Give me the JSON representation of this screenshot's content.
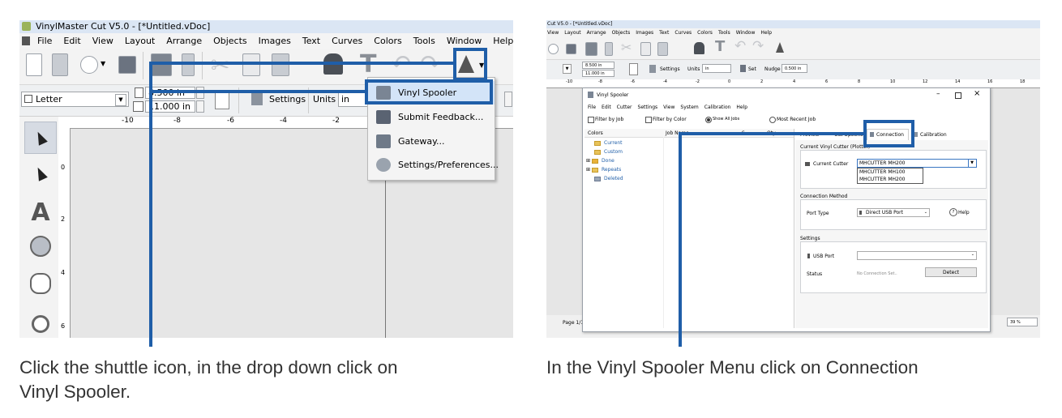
{
  "left_panel": {
    "window_title": "VinylMaster Cut V5.0 - [*Untitled.vDoc]",
    "menu": [
      "File",
      "Edit",
      "View",
      "Layout",
      "Arrange",
      "Objects",
      "Images",
      "Text",
      "Curves",
      "Colors",
      "Tools",
      "Window",
      "Help"
    ],
    "page_size": "Letter",
    "width_value": "8.500 in",
    "height_value": "11.000 in",
    "settings_label": "Settings",
    "units_label": "Units",
    "units_value": "in",
    "ruler_h": [
      "-10",
      "-8",
      "-6",
      "-4",
      "-2"
    ],
    "ruler_v": [
      "0",
      "2",
      "4",
      "6"
    ],
    "dropdown": [
      "Vinyl Spooler",
      "Submit Feedback...",
      "Gateway...",
      "Settings/Preferences..."
    ],
    "caption_line1": "Click the shuttle icon, in the drop down click on",
    "caption_line2": "Vinyl Spooler."
  },
  "right_panel": {
    "window_title": "Cut V5.0 - [*Untitled.vDoc]",
    "menu": [
      "View",
      "Layout",
      "Arrange",
      "Objects",
      "Images",
      "Text",
      "Curves",
      "Colors",
      "Tools",
      "Window",
      "Help"
    ],
    "width_value": "8.500 in",
    "height_value": "11.000 in",
    "settings_label": "Settings",
    "units_label": "Units",
    "units_value": "in",
    "set_label": "Set",
    "nudge_label": "Nudge",
    "nudge_value": "0.500 in",
    "ruler_h": [
      "-10",
      "-8",
      "-6",
      "-4",
      "-2",
      "0",
      "2",
      "4",
      "6",
      "8",
      "10",
      "12",
      "14",
      "16",
      "18"
    ],
    "page_label": "Page 1/1",
    "zoom_value": "39 %",
    "spooler": {
      "title": "Vinyl Spooler",
      "menu": [
        "File",
        "Edit",
        "Cutter",
        "Settings",
        "View",
        "System",
        "Calibration",
        "Help"
      ],
      "filter_job": "Filter by Job",
      "filter_color": "Filter by Color",
      "show_all": "Show All Jobs",
      "most_recent": "Most Recent Job",
      "col_colors": "Colors",
      "col_job_name": "Job Name",
      "col_s": "S...",
      "col_qty": "Qty",
      "tree": [
        "Current",
        "Custom",
        "Done",
        "Repeats",
        "Deleted"
      ],
      "tabs": [
        "Preview",
        "Cut Options",
        "Connection",
        "Calibration"
      ],
      "group_current": "Current Vinyl Cutter (Plotter)",
      "current_cutter_label": "Current Cutter",
      "current_cutter_value": "MHCUTTER MH200",
      "cutter_options": [
        "MHCUTTER MH100",
        "MHCUTTER MH200"
      ],
      "group_connection": "Connection Method",
      "port_type_label": "Port Type",
      "port_type_value": "Direct USB Port",
      "help_label": "Help",
      "group_settings": "Settings",
      "usb_port_label": "USB Port",
      "status_label": "Status",
      "status_value": "No Connection Set..",
      "detect_label": "Detect"
    },
    "caption": "In the Vinyl Spooler Menu click on Connection"
  },
  "colors": {
    "highlight_blue": "#1f5ea8",
    "caption_text": "#333333"
  }
}
